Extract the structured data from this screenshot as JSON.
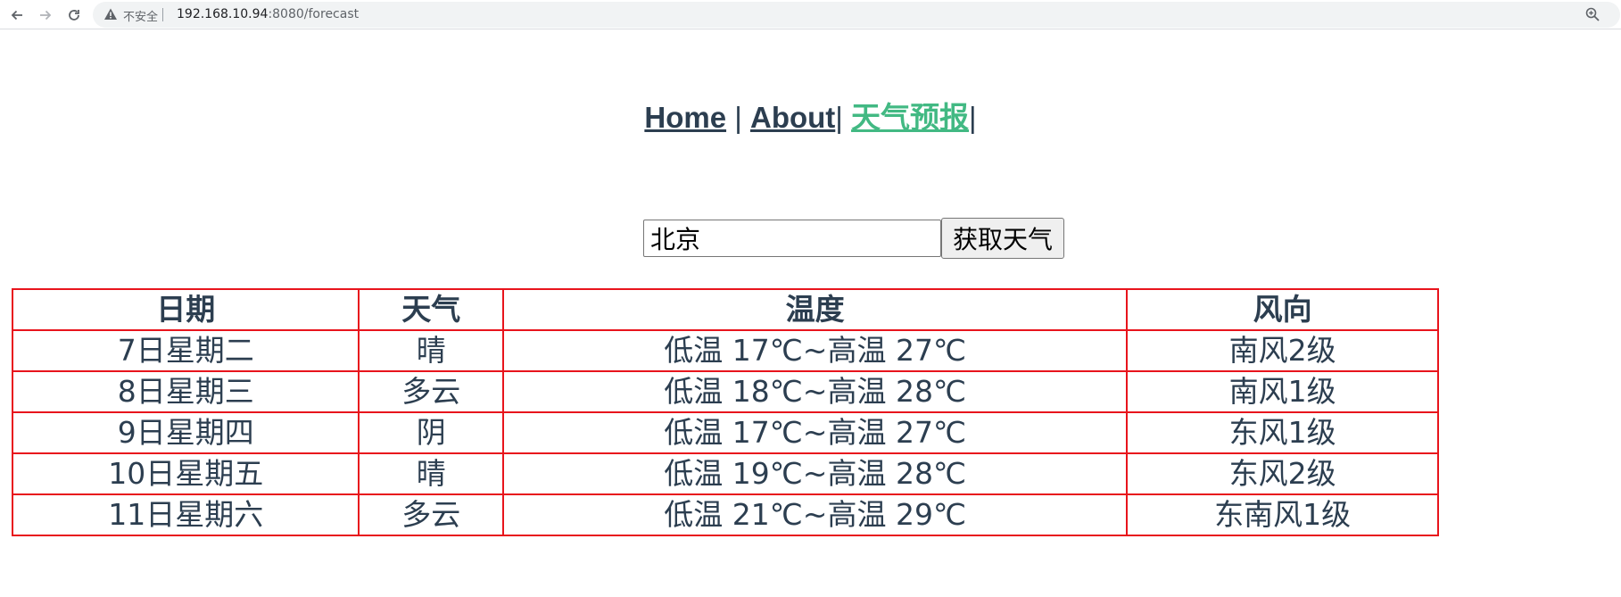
{
  "browser": {
    "security_label": "不安全",
    "url_host": "192.168.10.94",
    "url_rest": ":8080/forecast"
  },
  "nav": {
    "home": "Home",
    "separator_1": " | ",
    "about": "About",
    "separator_2": "| ",
    "forecast": "天气预报",
    "separator_3": "|"
  },
  "search": {
    "value": "北京",
    "button_label": "获取天气"
  },
  "table": {
    "headers": [
      "日期",
      "天气",
      "温度",
      "风向"
    ],
    "rows": [
      [
        "7日星期二",
        "晴",
        "低温 17℃~高温 27℃",
        "南风2级"
      ],
      [
        "8日星期三",
        "多云",
        "低温 18℃~高温 28℃",
        "南风1级"
      ],
      [
        "9日星期四",
        "阴",
        "低温 17℃~高温 27℃",
        "东风1级"
      ],
      [
        "10日星期五",
        "晴",
        "低温 19℃~高温 28℃",
        "东风2级"
      ],
      [
        "11日星期六",
        "多云",
        "低温 21℃~高温 29℃",
        "东南风1级"
      ]
    ]
  },
  "colors": {
    "text": "#2c3e50",
    "active_link": "#42b983",
    "table_border": "#e8141c"
  }
}
